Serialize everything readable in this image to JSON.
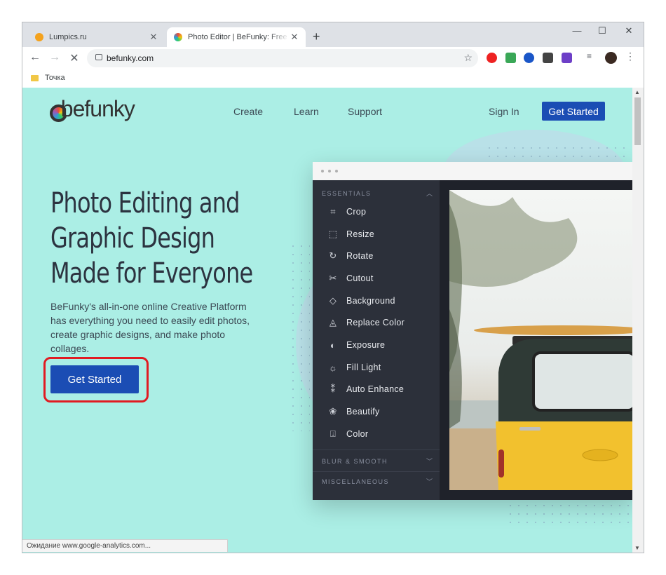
{
  "browser": {
    "tabs": [
      {
        "title": "Lumpics.ru",
        "favicon_color": "#f4a21d",
        "active": false
      },
      {
        "title": "Photo Editor | BeFunky: Free Onli",
        "favicon_color": "#4a90d9",
        "active": true
      }
    ],
    "window_controls": {
      "minimize": "—",
      "maximize": "☐",
      "close": "✕"
    },
    "url": "befunky.com",
    "bookmark": "Точка",
    "status_text": "Ожидание www.google-analytics.com..."
  },
  "site": {
    "logo": "befunky",
    "nav": [
      "Create",
      "Learn",
      "Support"
    ],
    "sign_in": "Sign In",
    "get_started_top": "Get Started",
    "headline": [
      "Photo Editing and",
      "Graphic Design",
      "Made for Everyone"
    ],
    "subtext": "BeFunky's all-in-one online Creative Platform has everything you need to easily edit photos, create graphic designs, and make photo collages.",
    "cta": "Get Started",
    "accent_color": "#1b4db4",
    "bg_color": "#abeee5"
  },
  "editor": {
    "section_essentials": "ESSENTIALS",
    "tools": [
      {
        "label": "Crop",
        "icon": "crop-icon"
      },
      {
        "label": "Resize",
        "icon": "resize-icon"
      },
      {
        "label": "Rotate",
        "icon": "rotate-icon"
      },
      {
        "label": "Cutout",
        "icon": "scissors-icon"
      },
      {
        "label": "Background",
        "icon": "background-icon"
      },
      {
        "label": "Replace Color",
        "icon": "drop-icon"
      },
      {
        "label": "Exposure",
        "icon": "exposure-icon"
      },
      {
        "label": "Fill Light",
        "icon": "sun-icon"
      },
      {
        "label": "Auto Enhance",
        "icon": "wand-icon"
      },
      {
        "label": "Beautify",
        "icon": "flower-icon"
      },
      {
        "label": "Color",
        "icon": "color-icon"
      }
    ],
    "section_blur": "BLUR & SMOOTH",
    "section_misc": "MISCELLANEOUS"
  }
}
